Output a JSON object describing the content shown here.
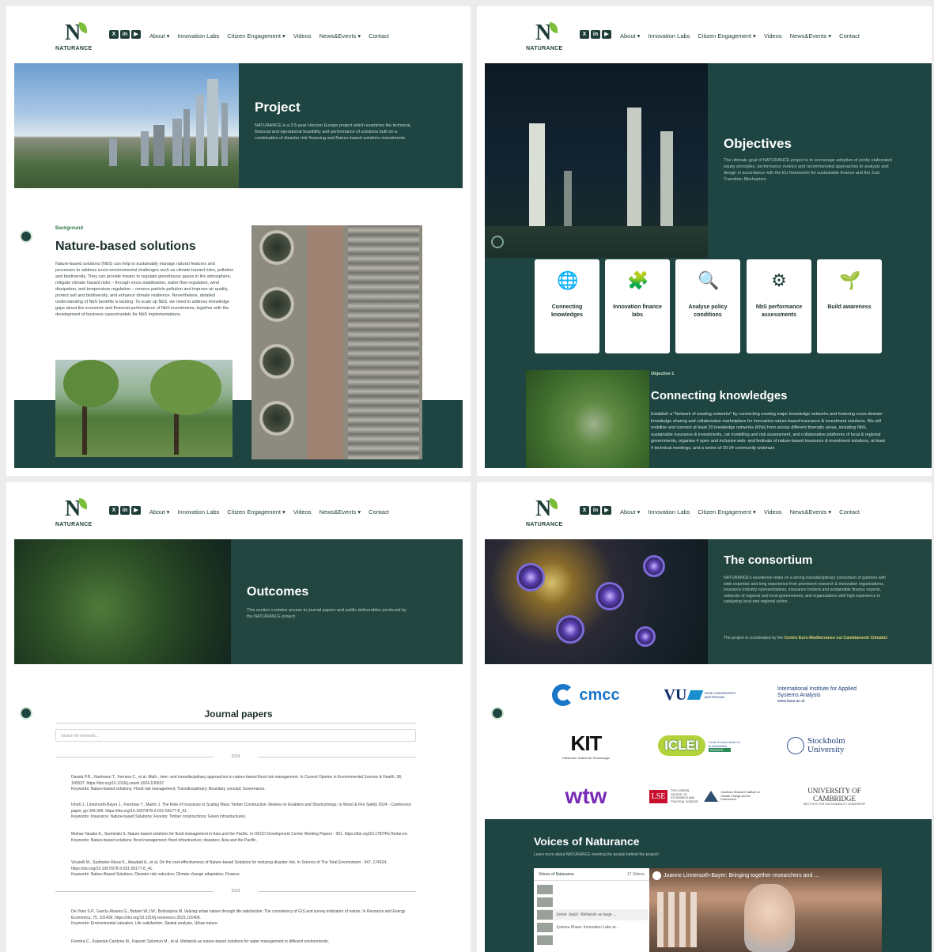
{
  "nav": {
    "logo_text": "NATURANCE",
    "social": [
      "X",
      "in",
      "▶"
    ],
    "menu": [
      "About ▾",
      "Innovation Labs",
      "Citizen Engagement ▾",
      "Videos",
      "News&Events ▾",
      "Contact"
    ]
  },
  "p1": {
    "hero_title": "Project",
    "hero_text": "NATURANCE is a 3.5-year Horizon Europe project which examines the technical, financial and operational feasibility and performance of solutions built on a combination of disaster risk financing and Nature-based solutions investments.",
    "label": "Background",
    "title": "Nature-based solutions",
    "body": "Nature-based solutions (NbS) can help to sustainably manage natural features and processes to address socio-environmental challenges such as climate-hazard risks, pollution and biodiversity. They can provide means to regulate greenhouse gases in the atmosphere, mitigate climate hazard risks – through moss stabilisation, water flow regulation, wind dissipation, and temperature regulation – remove particle pollution and improve air quality, protect soil and biodiversity, and enhance climate resilience. Nevertheless, detailed understanding of NbS benefits is lacking. To scale up NbS, we need to address knowledge gaps about the economic and financial performance of NbS investments, together with the development of business cases/models for NbS implementations."
  },
  "p2": {
    "title": "Objectives",
    "text": "The ultimate goal of NATURANCE project is to encourage adoption of jointly elaborated equity principles, performance metrics and recommended approaches to analysis and design in accordance with the EU framework for sustainable finance and the Just Transition Mechanism.",
    "cards": [
      {
        "icon": "globe-icon",
        "glyph": "🌐",
        "label": "Connecting knowledges"
      },
      {
        "icon": "puzzle-icon",
        "glyph": "🧩",
        "label": "Innovation finance labs"
      },
      {
        "icon": "magnifier-chart-icon",
        "glyph": "🔍",
        "label": "Analyse policy conditions"
      },
      {
        "icon": "network-icon",
        "glyph": "⚙",
        "label": "NbS performance assessments"
      },
      {
        "icon": "plant-crate-icon",
        "glyph": "🌱",
        "label": "Build awareness"
      }
    ],
    "obj_label": "Objective 1",
    "obj_title": "Connecting knowledges",
    "obj_text": "Establish a \"Network of existing networks\" by connecting existing major knowledge networks and fostering cross-domain knowledge sharing and collaborative marketplace for innovative nature-based insurance & investment solutions. We will mobilise and connect at least 20 knowledge networks (KNs) from across different thematic areas, including NbS, sustainable insurance & investments, cat modelling and risk assessment, and collaborative platforms of local & regional governments, organise 4 open and inclusive web- and festivals of nature-based insurance & investment solutions, at least 4 technical meetings, and a series of 20-24 community webinars"
  },
  "p3": {
    "title": "Outcomes",
    "text": "This section contains access to journal papers and public deliverables produced by the NATURANCE project",
    "jp_title": "Journal papers",
    "search_placeholder": "Search for keyword...",
    "year1": "2024",
    "year2": "2023",
    "refs": [
      {
        "text": "Davids P.R., Hartmann T., Ferreira C., et al. Multi-, inter- and transdisciplinary approaches to nature-based flood risk management. In Current Opinion in Environmental Science & Health, 38, 100537. https://doi.org/10.1016/j.coesh.2024.100537.",
        "kw": "Keywords: Nature-based solutions; Flood risk management; Transdisciplinary; Boundary concept; Governance."
      },
      {
        "text": "Ivholt J., Linnerooth-Bayer J., Foreman T., Martin J. The Role of Insurance in Scaling Mass Timber Construction: Review on Enablers and Shortcomings. In Wood & Fire Safety 2024 - Conference paper, pp 349-356. https://doi.org/10.1007/978-3-031-59177-8_41.",
        "kw": "Keywords: Insurance; Nature-based Solutions; Forests; Timber constructions; Green infrastructures."
      },
      {
        "text": "Molnar-Tanaka K., Surminski S. Nature-based solutions for flood management in Asia and the Pacific. In OECD Development Centre Working Papers - 351. https://doi.org/10.1787/f4c7bebe-en.",
        "kw": "Keywords: Nature-based solutions; flood management; flood infrastructure; disasters; Asia and the Pacific."
      },
      {
        "text": "Vicarelli M., Sudmeier-Rieux K., Alsadadi A., et al. On the cost-effectiveness of Nature-based Solutions for reducing disaster risk. In Science of The Total Environment - 947, 174524. https://doi.org/10.1007/978-3-031-59177-8_41.",
        "kw": "Keywords: Nature-Based Solutions; Disaster risk reduction; Climate change adaptation; Finance."
      },
      {
        "text": "De Vries S.P., García Álvarez G., Botzen W.J.W., Bočkarjova M. Valuing urban nature through life satisfaction: The consistency of GIS and survey indicators of nature. In Resource and Energy Economics, 75, 101406. https://doi.org/10.1016/j.reseneeco.2023.101406.",
        "kw": "Keywords: Environmental valuation, Life satisfaction, Spatial analysis, Urban nature."
      },
      {
        "text": "Ferreira C., Kalantari-Cardona M., Kapović Solomun M., et al. Wetlands as nature-based solutions for water management in different environments.",
        "kw": ""
      }
    ]
  },
  "p4": {
    "title": "The consortium",
    "text": "NATURANCE's excellence relies on a strong transdisciplinary consortium of partners with wide expertise and long experience from prominent research & innovation organisations, insurance industry representatives, insurance brokers and sustainable finance experts, networks of regional and local governments, and organisations with high experience in catalysing local and regional action.",
    "text2": "The project is coordinated by the",
    "coord": "Centro Euro-Mediterraneo sui Cambiamenti Climatici",
    "logos": {
      "cmcc": "cmcc",
      "vu": "VU",
      "vu_sub": "VRIJE UNIVERSITEIT AMSTERDAM",
      "iiasa": "International Institute for Applied Systems Analysis",
      "iiasa_url": "www.iiasa.ac.at",
      "kit": "KIT",
      "kit_sub": "Karlsruher Institut für Technologie",
      "iclei": "ICLEI",
      "iclei_sub": "Local Governments for Sustainability",
      "iclei_tag": "EUROPE",
      "stockholm": "Stockholm University",
      "wtw": "wtw",
      "lse": "LSE",
      "lse_sub": "THE LONDON SCHOOL OF ECONOMICS AND POLITICAL SCIENCE",
      "grantham": "Grantham Research Institute on Climate Change and the Environment",
      "cambridge": "UNIVERSITY OF CAMBRIDGE",
      "cambridge_sub": "INSTITUTE FOR SUSTAINABILITY LEADERSHIP"
    },
    "voices_title": "Voices of Naturance",
    "voices_sub": "Learn more about NATURANCE meeting the people behind the project!",
    "playlist": "Voices of Naturance",
    "count": "17 Videos",
    "items": [
      "",
      "",
      "Jorker Janjić: Wetlands as large ...",
      "Jyotsna Khara: Innovation Labs at ...",
      ""
    ],
    "video_title": "Joanne Linnerooth-Bayer: Bringing together researchers and ..."
  },
  "colors": {
    "primary": "#1e4541",
    "accent": "#7cbd3a",
    "highlight": "#d8d46c"
  }
}
